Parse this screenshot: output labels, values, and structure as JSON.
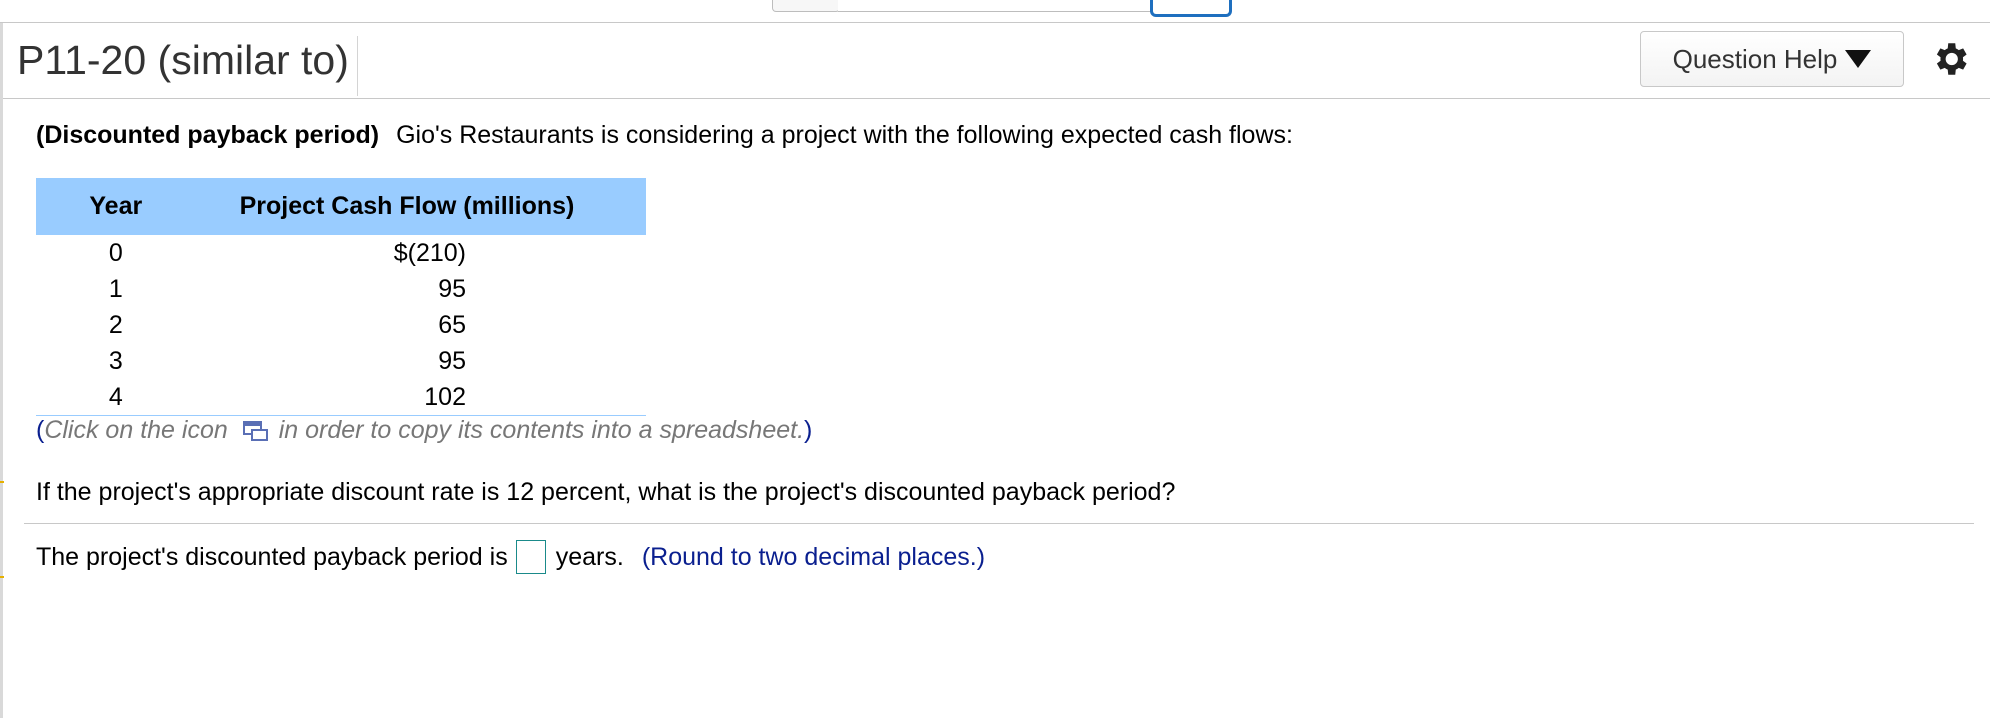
{
  "header": {
    "title": "P11-20 (similar to)",
    "help_label": "Question Help"
  },
  "problem": {
    "topic": "(Discounted payback period)",
    "intro": "Gio's Restaurants is considering a project with the following expected cash flows:",
    "table": {
      "headers": [
        "Year",
        "Project Cash Flow (millions)"
      ],
      "rows": [
        {
          "year": "0",
          "cash_flow": "$(210)"
        },
        {
          "year": "1",
          "cash_flow": "95"
        },
        {
          "year": "2",
          "cash_flow": "65"
        },
        {
          "year": "3",
          "cash_flow": "95"
        },
        {
          "year": "4",
          "cash_flow": "102"
        }
      ]
    },
    "copy_note": {
      "open": "(",
      "before": "Click on the icon",
      "after": "in order to copy its contents into a spreadsheet.",
      "close": ")"
    },
    "question": "If the project's appropriate discount rate is 12 percent, what is the project's discounted payback period?"
  },
  "answer": {
    "prefix": "The project's discounted payback period is",
    "value": "",
    "suffix": "years.",
    "round_note": "(Round to two decimal places.)"
  },
  "colors": {
    "table_header_bg": "#99ccff",
    "note_blue": "#0a1f8f",
    "focus_blue": "#1e6fbf"
  },
  "icons": [
    "caret-down-icon",
    "gear-icon",
    "copy-to-spreadsheet-icon"
  ]
}
